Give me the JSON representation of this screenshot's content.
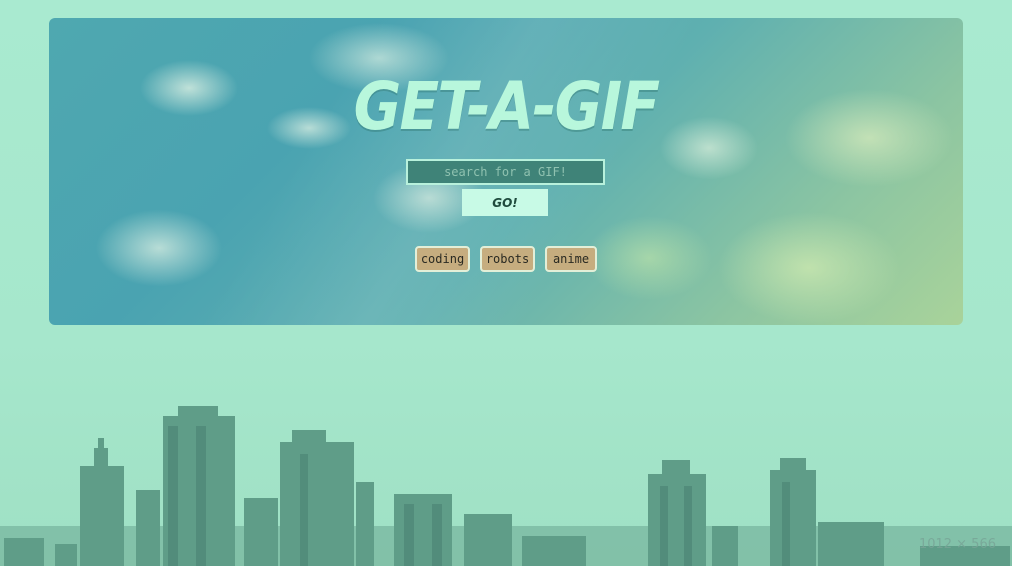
{
  "header": {
    "title": "GET-A-GIF"
  },
  "search": {
    "placeholder": "search for a GIF!",
    "value": "",
    "submit_label": "GO!"
  },
  "topics": [
    {
      "label": "coding"
    },
    {
      "label": "robots"
    },
    {
      "label": "anime"
    }
  ],
  "overlay": {
    "dimensions_label": "1012 × 566"
  },
  "colors": {
    "page_background": "#a9e8cf",
    "title": "#b8f7dc",
    "search_field": "#3f8378",
    "go_button": "#c8fae6",
    "topic_button": "#c6ad7f",
    "skyline": "#5c9a88"
  }
}
